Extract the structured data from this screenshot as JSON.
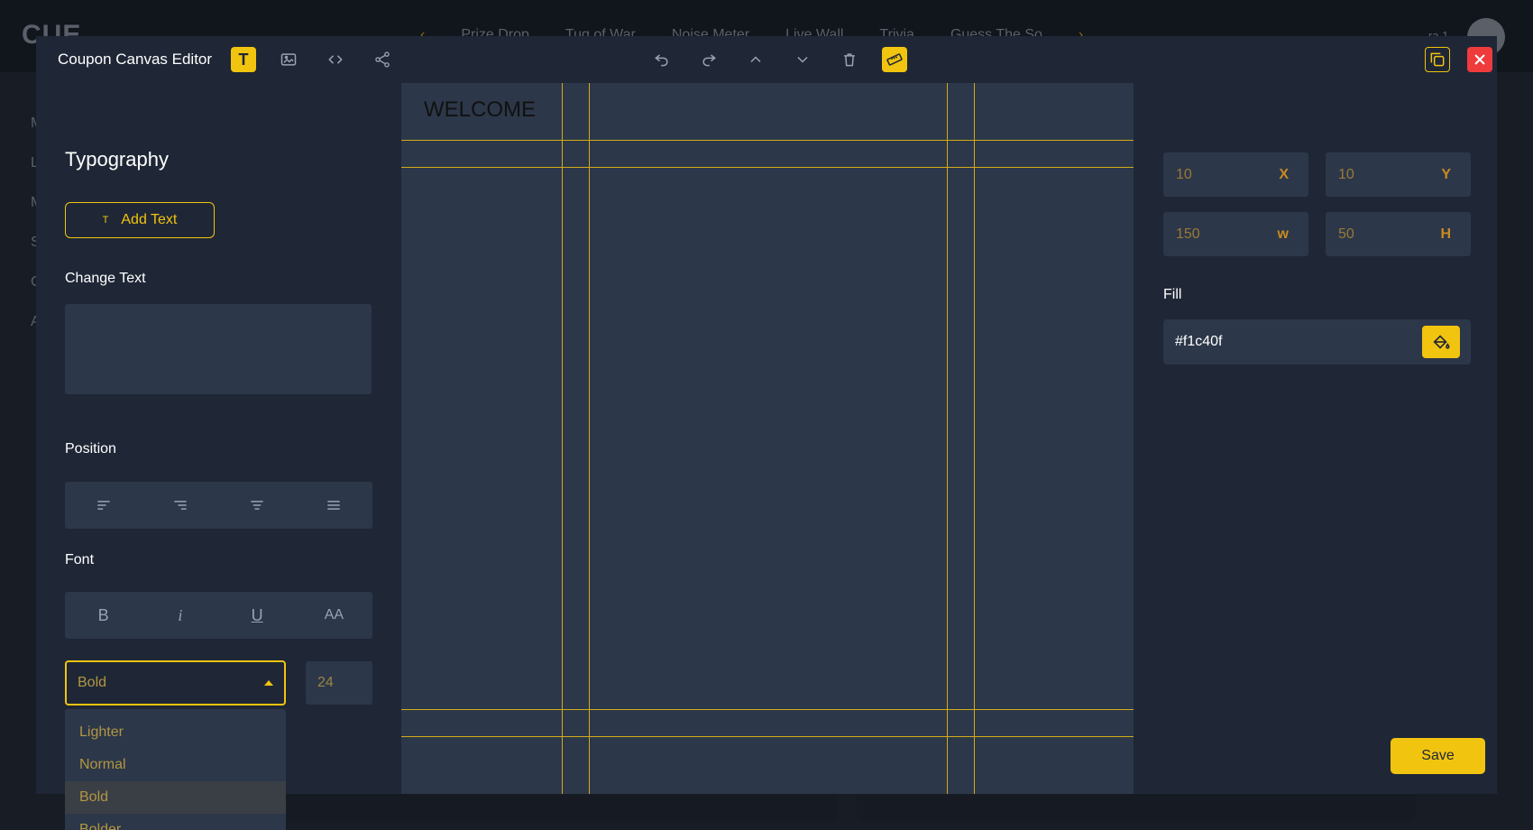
{
  "background": {
    "logo": "CUE",
    "nav_tabs": [
      "Prize Drop",
      "Tug of War",
      "Noise Meter",
      "Live Wall",
      "Trivia",
      "Guess The So"
    ],
    "user_label": "ra 1",
    "sidebar_letters": [
      "M",
      "L",
      "M",
      "S",
      "C",
      "A"
    ]
  },
  "header": {
    "title": "Coupon Canvas Editor",
    "left_tools": [
      "text-icon",
      "image-icon",
      "code-icon",
      "share-icon"
    ],
    "center_tools": [
      "undo-icon",
      "redo-icon",
      "chevron-up-icon",
      "chevron-down-icon",
      "trash-icon",
      "ruler-icon"
    ]
  },
  "left_panel": {
    "title": "Typography",
    "add_text_label": "Add Text",
    "change_text_label": "Change Text",
    "change_text_value": "",
    "position_label": "Position",
    "font_label": "Font",
    "font_style_buttons": [
      "B",
      "i",
      "U",
      "AA"
    ],
    "font_weight_selected": "Bold",
    "font_size": "24",
    "font_weight_options": [
      "Lighter",
      "Normal",
      "Bold",
      "Bolder"
    ]
  },
  "canvas": {
    "text": "WELCOME",
    "guide_color": "#d2ac18"
  },
  "right_panel": {
    "x_value": "10",
    "x_label": "X",
    "y_value": "10",
    "y_label": "Y",
    "w_value": "150",
    "w_label": "w",
    "h_value": "50",
    "h_label": "H",
    "fill_label": "Fill",
    "fill_value": "#f1c40f",
    "save_label": "Save"
  },
  "colors": {
    "accent": "#f1c40f",
    "modal_bg": "#1f2736",
    "field_bg": "#2c3749",
    "close": "#ef3b3b"
  }
}
